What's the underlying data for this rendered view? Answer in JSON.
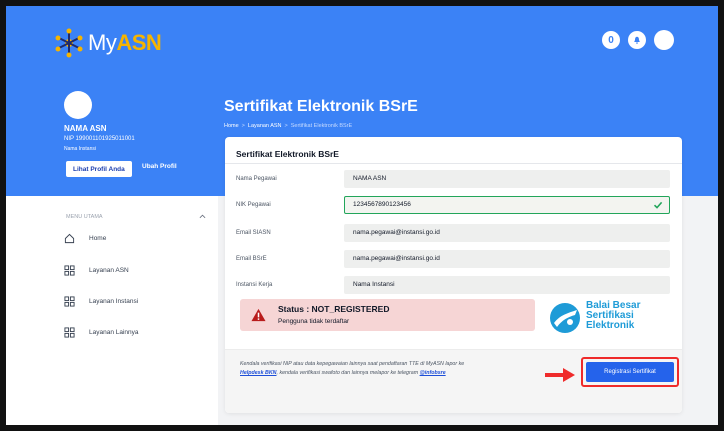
{
  "header": {
    "logo_my": "My",
    "logo_asn": "ASN",
    "notification_badge": "0"
  },
  "profile": {
    "name": "NAMA ASN",
    "nip": "NIP 199001101925011001",
    "instansi": "Nama Instansi",
    "btn_lihat": "Lihat Profil Anda",
    "btn_ubah": "Ubah Profil"
  },
  "page": {
    "title": "Sertifikat Elektronik BSrE",
    "breadcrumb": [
      "Home",
      "Layanan ASN",
      "Sertifikat Elektronik BSrE"
    ],
    "breadcrumb_sep": ">"
  },
  "sidebar": {
    "menu_label": "MENU UTAMA",
    "items": [
      {
        "label": "Home",
        "icon": "home-icon"
      },
      {
        "label": "Layanan ASN",
        "icon": "grid-icon"
      },
      {
        "label": "Layanan Instansi",
        "icon": "grid-icon"
      },
      {
        "label": "Layanan Lainnya",
        "icon": "grid-icon"
      }
    ]
  },
  "card": {
    "title": "Sertifikat Elektronik BSrE",
    "fields": [
      {
        "label": "Nama Pegawai",
        "value": "NAMA ASN"
      },
      {
        "label": "NIK Pegawai",
        "value": "1234567890123456"
      },
      {
        "label": "Email SIASN",
        "value": "nama.pegawai@instansi.go.id"
      },
      {
        "label": "Email BSrE",
        "value": "nama.pegawai@instansi.go.id"
      },
      {
        "label": "Instansi Kerja",
        "value": "Nama Instansi"
      }
    ],
    "status_title": "Status : NOT_REGISTERED",
    "status_desc": "Pengguna tidak terdaftar",
    "bsre_line1": "Balai Besar",
    "bsre_line2": "Sertifikasi",
    "bsre_line3": "Elektronik",
    "note_part1": "Kendala verifikasi NIP atau data kepegawaian lainnya saat pendaftaran TTE di MyASN lapor ke ",
    "note_link1": "Helpdesk BKN",
    "note_part2": ", kendala verifikasi swafoto dan lainnya melapor ke telegram ",
    "note_link2": "@infobsre",
    "register_button": "Registrasi Sertifikat"
  },
  "colors": {
    "brand_blue": "#3b82f6",
    "button_blue": "#2563eb",
    "error_bg": "#f6d5d5",
    "highlight_red": "#ef2b2b",
    "valid_green": "#22a55a"
  }
}
